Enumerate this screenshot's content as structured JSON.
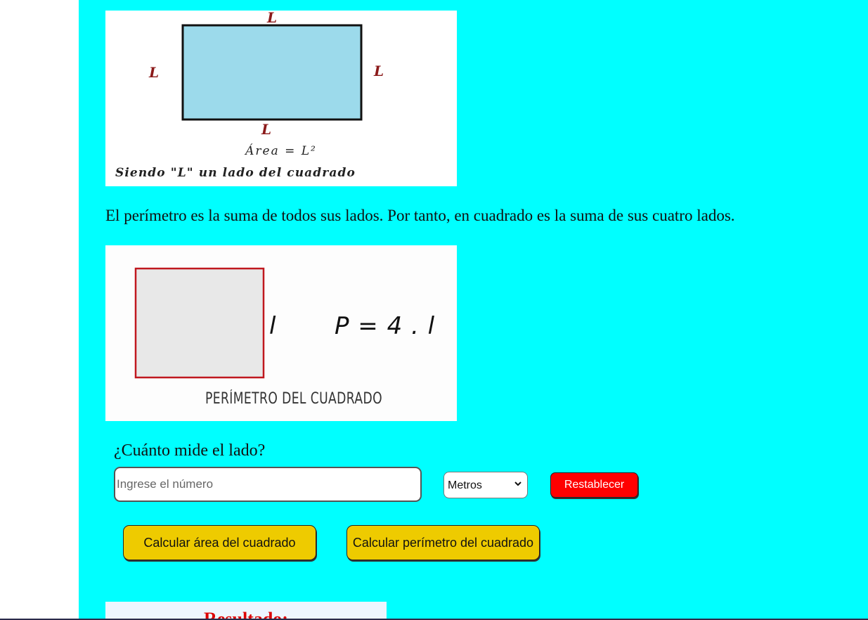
{
  "area_figure": {
    "side_label": "L",
    "formula": "Área = L²",
    "caption": "Siendo \"L\" un lado del cuadrado",
    "fill_color": "#9cdaeb",
    "label_color": "#8b1a1a"
  },
  "perimeter_text": "El perímetro es la suma de todos sus lados. Por tanto, en cuadrado es la suma de sus cuatro lados.",
  "perimeter_figure": {
    "side_label": "l",
    "formula": "P = 4 . l",
    "caption": "PERÍMETRO DEL CUADRADO",
    "square_fill": "#e8e8e8",
    "square_border": "#c0181f"
  },
  "form": {
    "question": "¿Cuánto mide el lado?",
    "input_value": "",
    "input_placeholder": "Ingrese el número",
    "unit_selected": "Metros",
    "reset_label": "Restablecer",
    "calc_area_label": "Calcular área del cuadrado",
    "calc_perimeter_label": "Calcular perímetro del cuadrado"
  },
  "result": {
    "title": "Resultado:"
  },
  "colors": {
    "page_background": "#00ffff",
    "reset_button": "#ff0000",
    "calc_button": "#eecb00",
    "result_title": "#dd0000"
  }
}
